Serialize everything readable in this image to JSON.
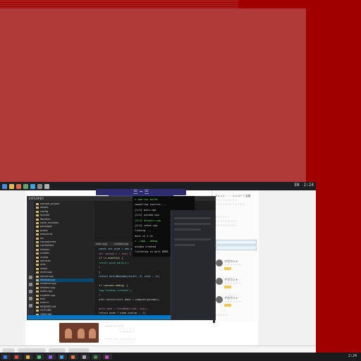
{
  "top_taskbar": {
    "tray_time": "2:24",
    "tray_label": "EN"
  },
  "browser": {
    "banner_text": "三 ─ 三",
    "comment_panel": {
      "header_lines": [
        "コメント・・・メンバー  ▽ 記録",
        "・・・・・・・・・",
        "・・・・・・・・・・・・"
      ],
      "section_lines": [
        "・・・・・・",
        "・・・・・・・・・",
        "・・・・・・・・・"
      ],
      "comments": [
        {
          "name": "アカウント",
          "text": "・・・・・・"
        },
        {
          "name": "アカウント",
          "text": "・・・・・・"
        },
        {
          "name": "アカウント",
          "text": "・・・・・・"
        }
      ],
      "footer": "・・・・・"
    },
    "bottom": {
      "title": "・・・・・・・",
      "link": "・・・・・",
      "meta": "・・・・・ ・・・・・・"
    }
  },
  "vscode": {
    "title": "EXPLORER",
    "explorer_rows": [
      "sample_project",
      "assets",
      "config",
      "include",
      "libraries",
      "node_modules",
      "packages",
      "public",
      "resources",
      "src",
      "components",
      "controllers",
      "helpers",
      "models",
      "routes",
      "services",
      "utils",
      "views",
      "main.cpp",
      "server.cpp",
      "window.cpp",
      "renderer.cpp",
      "helpers.cpp",
      "index.cpp",
      "module.cpp",
      "test",
      "main.h",
      "README.md",
      "OUTLINE",
      "TIMELINE"
    ],
    "selected_row": 20,
    "tabs": [
      "main.cpp",
      "window.cpp",
      "helpers.cpp",
      "index.cpp",
      "README.md",
      "module.cpp"
    ],
    "code_lines": [
      "  const int size = vec.size();",
      "  for (auto& v : vec) {",
      "    if (v.enabled) {",
      "      result.push_back(v);",
      "    }",
      "  }",
      "  return buildWindow(result, 0, size - 1);",
      "",
      "  if (params.debug) {",
      "    log(\"window created\");",
      "  }",
      "  std::vector<int> data = compute(params);",
      "",
      "  auto node = findNode(root, key);",
      "  return node ? node->value : -1;"
    ]
  },
  "terminal": {
    "lines": [
      "> npm run build",
      "  compiling sources ...",
      "  [1/4] main.cpp",
      "  [2/4] window.cpp",
      "  [3/4] helpers.cpp",
      "  [4/4] index.cpp",
      "  linking ...",
      "  done in 2.4s",
      "> ./app --debug",
      "  window created",
      "  listening on port 8080"
    ]
  },
  "taskbar": {
    "items": [
      "",
      "",
      "",
      "",
      "",
      "",
      "",
      "",
      "",
      ""
    ],
    "clock": "2:24"
  }
}
